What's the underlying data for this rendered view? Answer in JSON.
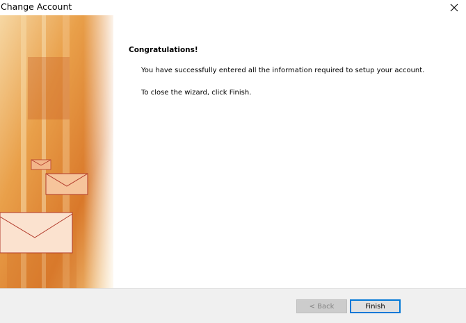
{
  "window": {
    "title": "Change Account"
  },
  "content": {
    "heading": "Congratulations!",
    "line1": "You have successfully entered all the information required to setup your account.",
    "line2": "To close the wizard, click Finish."
  },
  "buttons": {
    "back": "< Back",
    "finish": "Finish"
  },
  "colors": {
    "accent": "#0078d7",
    "art_orange": "#e08a2a",
    "footer_bg": "#f0f0f0"
  },
  "icons": {
    "close": "close-icon",
    "art": "envelope-icon"
  }
}
